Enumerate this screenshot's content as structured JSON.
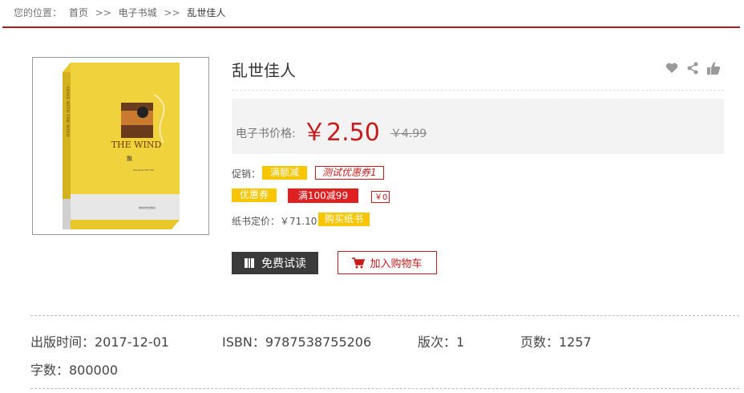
{
  "breadcrumb": {
    "prefix": "您的位置：",
    "home": "首页",
    "sep1": ">>",
    "store": "电子书城",
    "sep2": ">>",
    "current": "乱世佳人"
  },
  "book": {
    "title": "乱世佳人",
    "cover_alt": "GONE WITH THE WIND",
    "price_label": "电子书价格:",
    "price": "￥2.50",
    "original_price": "￥4.99",
    "promo_label": "促销：",
    "promo_tag_1": "满额减",
    "promo_tag_2": "测试优惠券1",
    "coupon_label": "优惠券",
    "coupon_1": "满100减99",
    "coupon_2": "￥0",
    "paper_price_label": "纸书定价：￥71.10",
    "buy_paper": "购买纸书",
    "trial_read": "免费试读",
    "add_cart": "加入购物车"
  },
  "details": {
    "publish_date": "出版时间：2017-12-01",
    "isbn": "ISBN：9787538755206",
    "edition": "版次：1",
    "pages": "页数：1257",
    "word_count": "字数：800000"
  },
  "icons": [
    "heart-icon",
    "share-icon",
    "thumbs-up-icon",
    "book-icon",
    "cart-icon"
  ],
  "colors": {
    "accent_red": "#c81b1b",
    "tag_yellow": "#f7c600",
    "dark_button": "#3a3a3a"
  }
}
